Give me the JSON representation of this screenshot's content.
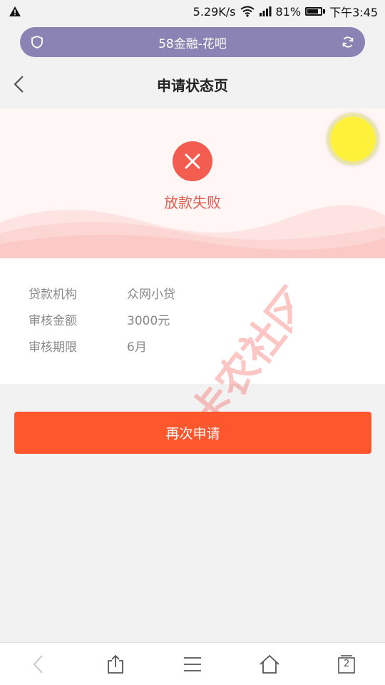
{
  "status_bar": {
    "network_speed": "5.29K/s",
    "battery": "81%",
    "time": "下午3:45",
    "battery_level": 0.81
  },
  "url_bar": {
    "title": "58金融-花吧"
  },
  "header": {
    "title": "申请状态页"
  },
  "status": {
    "text": "放款失败"
  },
  "info": {
    "rows": [
      {
        "label": "贷款机构",
        "value": "众网小贷"
      },
      {
        "label": "审核金额",
        "value": "3000元"
      },
      {
        "label": "审核期限",
        "value": "6月"
      }
    ]
  },
  "actions": {
    "reapply_label": "再次申请"
  },
  "watermark": {
    "text": "卡农社区"
  },
  "toolbar": {
    "tab_count": "2"
  },
  "colors": {
    "primary": "#fe572d",
    "fail": "#f25d50",
    "url_bar": "#8a83b3"
  }
}
